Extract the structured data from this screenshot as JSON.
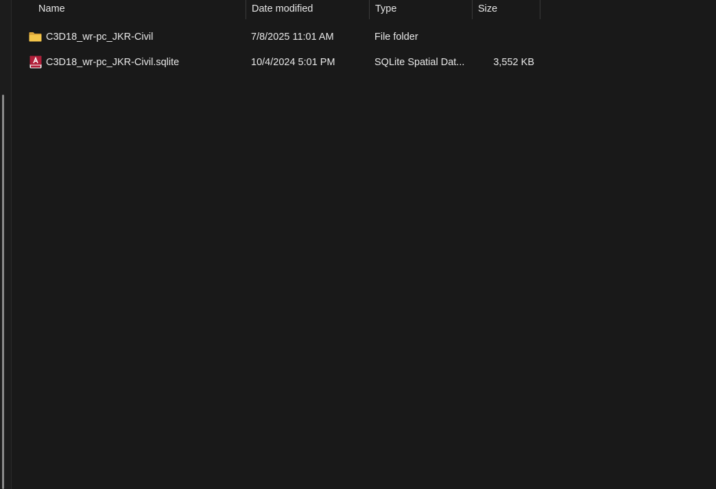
{
  "columns": {
    "name": "Name",
    "date_modified": "Date modified",
    "type": "Type",
    "size": "Size"
  },
  "files": [
    {
      "name": "C3D18_wr-pc_JKR-Civil",
      "date_modified": "7/8/2025 11:01 AM",
      "type": "File folder",
      "size": "",
      "icon": "folder-icon"
    },
    {
      "name": "C3D18_wr-pc_JKR-Civil.sqlite",
      "date_modified": "10/4/2024 5:01 PM",
      "type": "SQLite Spatial Dat...",
      "size": "3,552 KB",
      "icon": "sqlite-file-icon"
    }
  ],
  "colors": {
    "background": "#191919",
    "text": "#e8e8e8",
    "folder": "#f4c54a",
    "sqlite_badge": "#b0203a"
  }
}
